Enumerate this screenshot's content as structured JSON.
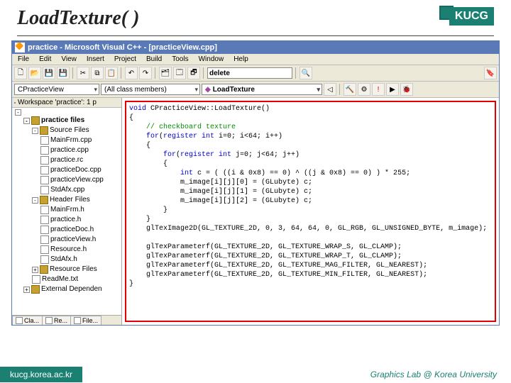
{
  "slide": {
    "title": "LoadTexture( )",
    "kucg": "KUCG",
    "footer_url": "kucg.korea.ac.kr",
    "footer_lab": "Graphics Lab @ Korea University"
  },
  "ide": {
    "window_title": "practice - Microsoft Visual C++ - [practiceView.cpp]",
    "menus": [
      "File",
      "Edit",
      "View",
      "Insert",
      "Project",
      "Build",
      "Tools",
      "Window",
      "Help"
    ],
    "toolbar2_input_value": "delete",
    "combo_class": "CPracticeView",
    "combo_members": "(All class members)",
    "combo_function": "LoadTexture",
    "workspace_title": "Workspace 'practice': 1 p",
    "tree": [
      {
        "depth": 0,
        "ic": "expander",
        "sign": "-",
        "txt": "",
        "extra": true
      },
      {
        "depth": 1,
        "ic": "folder",
        "txt": "practice files",
        "bold": true,
        "sign": "-"
      },
      {
        "depth": 2,
        "ic": "folder",
        "txt": "Source Files",
        "sign": "-"
      },
      {
        "depth": 3,
        "ic": "file",
        "txt": "MainFrm.cpp"
      },
      {
        "depth": 3,
        "ic": "file",
        "txt": "practice.cpp"
      },
      {
        "depth": 3,
        "ic": "file",
        "txt": "practice.rc"
      },
      {
        "depth": 3,
        "ic": "file",
        "txt": "practiceDoc.cpp"
      },
      {
        "depth": 3,
        "ic": "file",
        "txt": "practiceView.cpp"
      },
      {
        "depth": 3,
        "ic": "file",
        "txt": "StdAfx.cpp"
      },
      {
        "depth": 2,
        "ic": "folder",
        "txt": "Header Files",
        "sign": "-"
      },
      {
        "depth": 3,
        "ic": "file",
        "txt": "MainFrm.h"
      },
      {
        "depth": 3,
        "ic": "file",
        "txt": "practice.h"
      },
      {
        "depth": 3,
        "ic": "file",
        "txt": "practiceDoc.h"
      },
      {
        "depth": 3,
        "ic": "file",
        "txt": "practiceView.h"
      },
      {
        "depth": 3,
        "ic": "file",
        "txt": "Resource.h"
      },
      {
        "depth": 3,
        "ic": "file",
        "txt": "StdAfx.h"
      },
      {
        "depth": 2,
        "ic": "folder",
        "txt": "Resource Files",
        "sign": "+"
      },
      {
        "depth": 2,
        "ic": "file",
        "txt": "ReadMe.txt"
      },
      {
        "depth": 1,
        "ic": "folder",
        "txt": "External Dependen",
        "sign": "+"
      }
    ],
    "ws_tabs": [
      "Cla...",
      "Re...",
      "File..."
    ],
    "code": {
      "l1_a": "void",
      "l1_b": " CPracticeView::LoadTexture()",
      "l2": "{",
      "l3": "    // checkboard texture",
      "l4_a": "    for",
      "l4_b": "(",
      "l4_c": "register int",
      "l4_d": " i=0; i<64; i++)",
      "l5": "    {",
      "l6_a": "        for",
      "l6_b": "(",
      "l6_c": "register int",
      "l6_d": " j=0; j<64; j++)",
      "l7": "        {",
      "l8_a": "            int",
      "l8_b": " c = ( ((i & 0x8) == 0) ^ ((j & 0x8) == 0) ) * 255;",
      "l9": "            m_image[i][j][0] = (GLubyte) c;",
      "l10": "            m_image[i][j][1] = (GLubyte) c;",
      "l11": "            m_image[i][j][2] = (GLubyte) c;",
      "l12": "        }",
      "l13": "    }",
      "l14": "    glTexImage2D(GL_TEXTURE_2D, 0, 3, 64, 64, 0, GL_RGB, GL_UNSIGNED_BYTE, m_image);",
      "l15": "",
      "l16": "    glTexParameterf(GL_TEXTURE_2D, GL_TEXTURE_WRAP_S, GL_CLAMP);",
      "l17": "    glTexParameterf(GL_TEXTURE_2D, GL_TEXTURE_WRAP_T, GL_CLAMP);",
      "l18": "    glTexParameterf(GL_TEXTURE_2D, GL_TEXTURE_MAG_FILTER, GL_NEAREST);",
      "l19": "    glTexParameterf(GL_TEXTURE_2D, GL_TEXTURE_MIN_FILTER, GL_NEAREST);",
      "l20": "}"
    }
  }
}
